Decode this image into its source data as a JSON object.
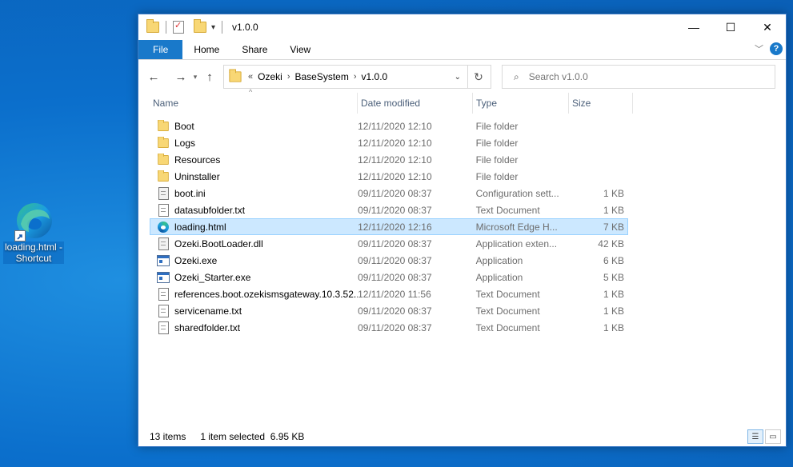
{
  "desktop": {
    "shortcut_label": "loading.html - Shortcut"
  },
  "window": {
    "title": "v1.0.0",
    "controls": {
      "minimize": "—",
      "maximize": "☐",
      "close": "✕"
    }
  },
  "ribbon": {
    "tabs": [
      "File",
      "Home",
      "Share",
      "View"
    ],
    "help": "?"
  },
  "nav": {
    "breadcrumb_overflow": "«",
    "crumbs": [
      "Ozeki",
      "BaseSystem",
      "v1.0.0"
    ],
    "search_placeholder": "Search v1.0.0"
  },
  "columns": {
    "name": "Name",
    "date": "Date modified",
    "type": "Type",
    "size": "Size"
  },
  "files": [
    {
      "name": "Boot",
      "date": "12/11/2020 12:10",
      "type": "File folder",
      "size": "",
      "icon": "folder"
    },
    {
      "name": "Logs",
      "date": "12/11/2020 12:10",
      "type": "File folder",
      "size": "",
      "icon": "folder"
    },
    {
      "name": "Resources",
      "date": "12/11/2020 12:10",
      "type": "File folder",
      "size": "",
      "icon": "folder"
    },
    {
      "name": "Uninstaller",
      "date": "12/11/2020 12:10",
      "type": "File folder",
      "size": "",
      "icon": "folder"
    },
    {
      "name": "boot.ini",
      "date": "09/11/2020 08:37",
      "type": "Configuration sett...",
      "size": "1 KB",
      "icon": "config"
    },
    {
      "name": "datasubfolder.txt",
      "date": "09/11/2020 08:37",
      "type": "Text Document",
      "size": "1 KB",
      "icon": "text"
    },
    {
      "name": "loading.html",
      "date": "12/11/2020 12:16",
      "type": "Microsoft Edge H...",
      "size": "7 KB",
      "icon": "edge"
    },
    {
      "name": "Ozeki.BootLoader.dll",
      "date": "09/11/2020 08:37",
      "type": "Application exten...",
      "size": "42 KB",
      "icon": "config"
    },
    {
      "name": "Ozeki.exe",
      "date": "09/11/2020 08:37",
      "type": "Application",
      "size": "6 KB",
      "icon": "exe"
    },
    {
      "name": "Ozeki_Starter.exe",
      "date": "09/11/2020 08:37",
      "type": "Application",
      "size": "5 KB",
      "icon": "exe"
    },
    {
      "name": "references.boot.ozekismsgateway.10.3.52...",
      "date": "12/11/2020 11:56",
      "type": "Text Document",
      "size": "1 KB",
      "icon": "text"
    },
    {
      "name": "servicename.txt",
      "date": "09/11/2020 08:37",
      "type": "Text Document",
      "size": "1 KB",
      "icon": "text"
    },
    {
      "name": "sharedfolder.txt",
      "date": "09/11/2020 08:37",
      "type": "Text Document",
      "size": "1 KB",
      "icon": "text"
    }
  ],
  "selected_index": 6,
  "status": {
    "count": "13 items",
    "selection": "1 item selected  6.95 KB"
  },
  "colors": {
    "accent": "#1979ca",
    "selection_bg": "#cce8ff",
    "selection_border": "#99d1ff",
    "desktop_bg": "#0b6fcc"
  }
}
